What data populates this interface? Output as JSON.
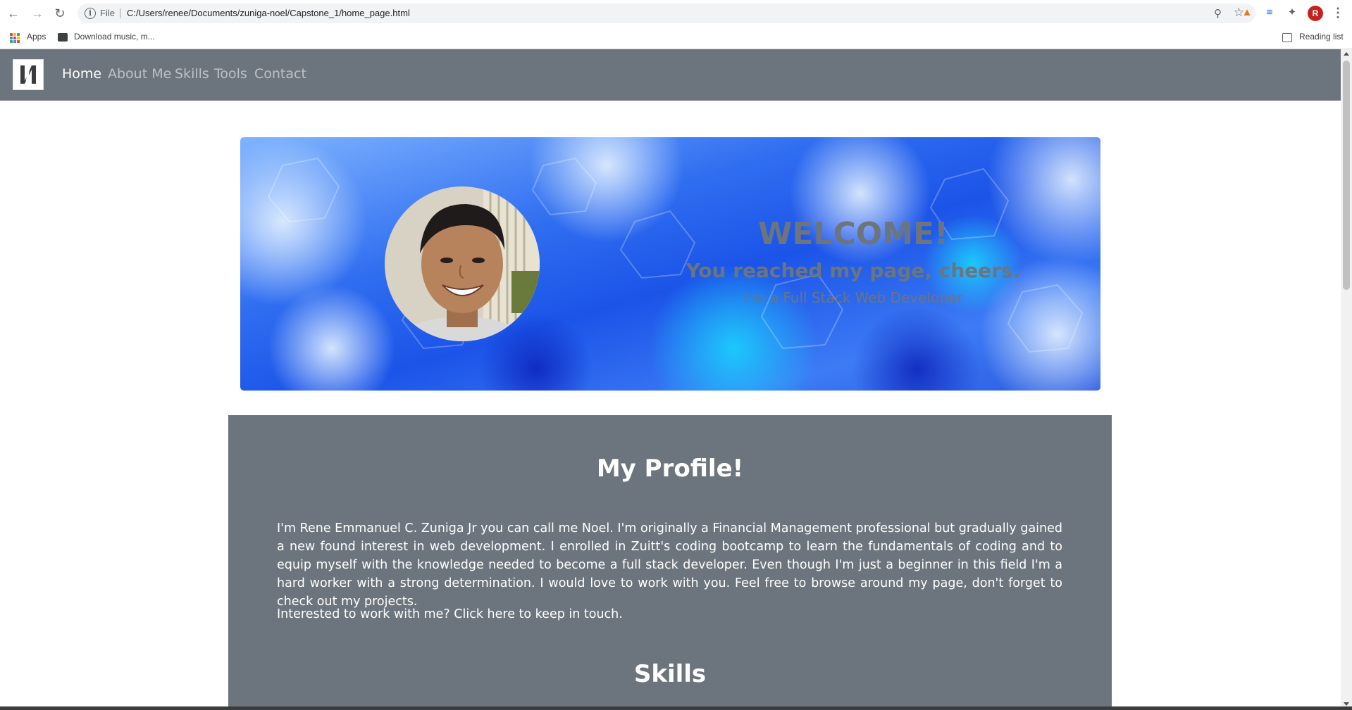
{
  "browser": {
    "file_label": "File",
    "url": "C:/Users/renee/Documents/zuniga-noel/Capstone_1/home_page.html",
    "avatar_letter": "R",
    "bookmarks": {
      "apps_label": "Apps",
      "download_label": "Download music, m...",
      "reading_list_label": "Reading list"
    }
  },
  "navbar": {
    "links": [
      "Home",
      "About Me",
      "Skills",
      "Tools",
      "Contact"
    ],
    "active": "Home"
  },
  "hero": {
    "welcome": "WELCOME!",
    "subtitle": "You reached my page, cheers.",
    "tagline": "I'm a Full Stack Web Developer"
  },
  "profile": {
    "title": "My Profile!",
    "paragraph": "I'm Rene Emmanuel C. Zuniga Jr you can call me Noel. I'm originally a Financial Management professional but gradually gained a new found interest in web development. I enrolled in Zuitt's coding bootcamp to learn the fundamentals of coding and to equip myself with the knowledge needed to become a full stack developer. Even though I'm just a beginner in this field I'm a hard worker with a strong determination. I would love to work with you. Feel free to browse around my page, don't forget to check out my projects.",
    "contact_line": "Interested to work with me? Click here to keep in touch.",
    "skills_title": "Skills"
  },
  "colors": {
    "navbar_bg": "#6c757d",
    "section_bg": "#6c757d",
    "hero_text": "#6c757d"
  }
}
